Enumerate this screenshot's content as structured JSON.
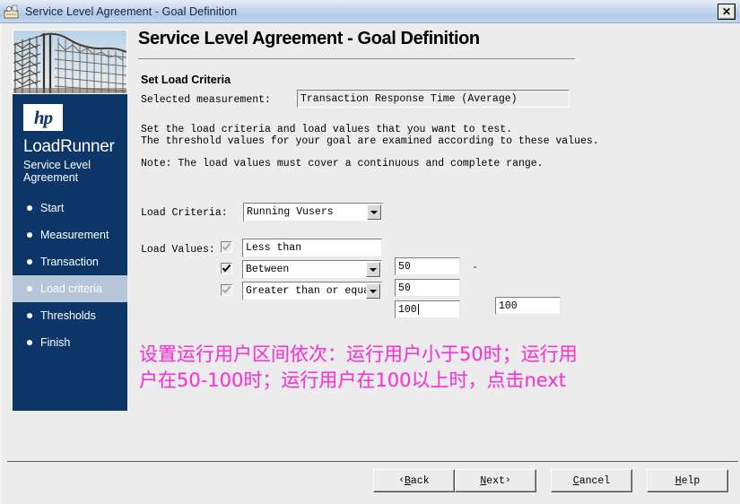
{
  "window": {
    "title": "Service Level Agreement - Goal Definition",
    "icon": "sla-wizard-icon",
    "close_label": "✕"
  },
  "sidebar": {
    "photo_alt": "rollercoaster-photo",
    "logo_text": "hp",
    "brand_main": "LoadRunner",
    "brand_sub": "Service Level\nAgreement",
    "items": [
      {
        "label": "Start",
        "active": false
      },
      {
        "label": "Measurement",
        "active": false
      },
      {
        "label": "Transaction",
        "active": false
      },
      {
        "label": "Load criteria",
        "active": true
      },
      {
        "label": "Thresholds",
        "active": false
      },
      {
        "label": "Finish",
        "active": false
      }
    ]
  },
  "content": {
    "page_title": "Service Level Agreement - Goal Definition",
    "section_title": "Set Load Criteria",
    "selected_measurement_label": "Selected measurement:",
    "selected_measurement_value": "Transaction Response Time (Average)",
    "description": "Set the load criteria and load values that you want to test.\nThe threshold values for your goal are examined according to these values.",
    "note": "Note: The load values must cover a continuous and complete range.",
    "load_criteria_label": "Load Criteria:",
    "load_criteria_value": "Running Vusers",
    "load_values_label": "Load Values:",
    "rows": [
      {
        "checked": true,
        "enabled": false,
        "criterion": "Less than",
        "has_dropdown": false,
        "value1": "50",
        "has_range": false,
        "dash": "",
        "value2": "",
        "focused": false
      },
      {
        "checked": true,
        "enabled": true,
        "criterion": "Between",
        "has_dropdown": true,
        "value1": "50",
        "has_range": true,
        "dash": "-",
        "value2": "100",
        "focused": false
      },
      {
        "checked": true,
        "enabled": false,
        "criterion": "Greater than or equal t",
        "has_dropdown": true,
        "value1": "100",
        "has_range": false,
        "dash": "",
        "value2": "",
        "focused": true
      }
    ]
  },
  "annotation": {
    "text": "设置运行用户区间依次：运行用户小于50时；运行用户在50-100时；运行用户在100以上时，点击next",
    "color": "#f03ad2"
  },
  "footer": {
    "back": {
      "prefix": "‹ ",
      "accel": "B",
      "rest": "ack",
      "suffix": ""
    },
    "next": {
      "prefix": "",
      "accel": "N",
      "rest": "ext",
      "suffix": " ›"
    },
    "cancel": {
      "prefix": "",
      "accel": "C",
      "rest": "ancel",
      "suffix": ""
    },
    "help": {
      "prefix": "",
      "accel": "H",
      "rest": "elp",
      "suffix": ""
    }
  },
  "colors": {
    "brand_navy": "#0d3668",
    "nav_active_bg": "#b6c6d8",
    "titlebar": "#b2cae6",
    "window_bg": "#ececec",
    "annotation": "#f03ad2"
  }
}
